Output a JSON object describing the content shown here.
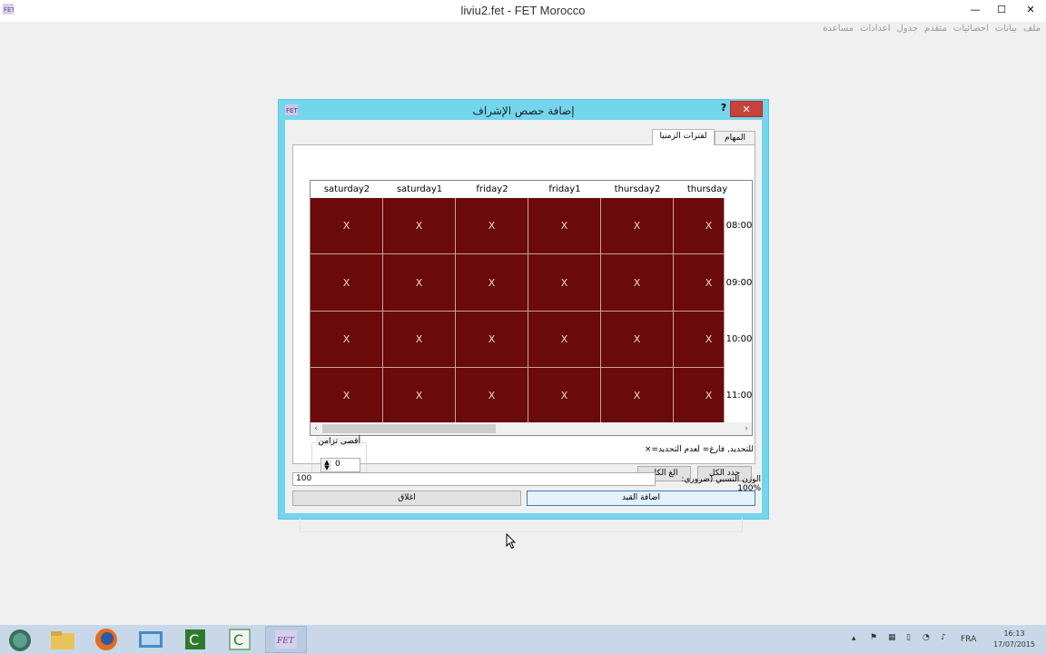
{
  "window": {
    "title": "liviu2.fet - FET Morocco",
    "controls": {
      "minimize": "—",
      "maximize": "☐",
      "close": "✕"
    }
  },
  "menu": [
    "ملف",
    "بيانات",
    "احصائيات",
    "متقدم",
    "جدول",
    "اعدادات",
    "مساعدة"
  ],
  "dialog": {
    "title": "إضافة حصص الإشراف",
    "help": "?",
    "close": "✕",
    "tabs": [
      "المهام",
      "لفترات الزمنيا"
    ],
    "columns": [
      "saturday2",
      "saturday1",
      "friday2",
      "friday1",
      "thursday2",
      "thursday"
    ],
    "rows": [
      {
        "time": "08:00",
        "cells": [
          "X",
          "X",
          "X",
          "X",
          "X",
          "X"
        ]
      },
      {
        "time": "09:00",
        "cells": [
          "X",
          "X",
          "X",
          "X",
          "X",
          "X"
        ]
      },
      {
        "time": "10:00",
        "cells": [
          "X",
          "X",
          "X",
          "X",
          "X",
          "X"
        ]
      },
      {
        "time": "11:00",
        "cells": [
          "X",
          "X",
          "X",
          "X",
          "X",
          "X"
        ]
      }
    ],
    "scroll_left": "‹",
    "scroll_right": "›",
    "legend": "×=للتحديد, فارغ= لعدم التحديد",
    "select_all": "حدد الكل",
    "deselect_all": "الغ الكل",
    "max_overlap_label": "أقصى تزامن",
    "max_overlap_value": "0",
    "weight_label": "الوزن النسبي (ضروري: 100%",
    "weight_value": "100",
    "add_button": "اضافة القيد",
    "close_button": "اغلاق"
  },
  "taskbar": {
    "language": "FRA",
    "time": "16:13",
    "date": "17/07/2015",
    "apps": [
      "start-icon",
      "file-explorer-icon",
      "firefox-icon",
      "remote-desktop-icon",
      "camtasia-icon",
      "camtasia-recorder-icon",
      "fet-icon"
    ]
  },
  "colors": {
    "cell_bg": "#6b0a0a",
    "dialog_frame": "#73d6ec",
    "close_red": "#c7423a"
  }
}
